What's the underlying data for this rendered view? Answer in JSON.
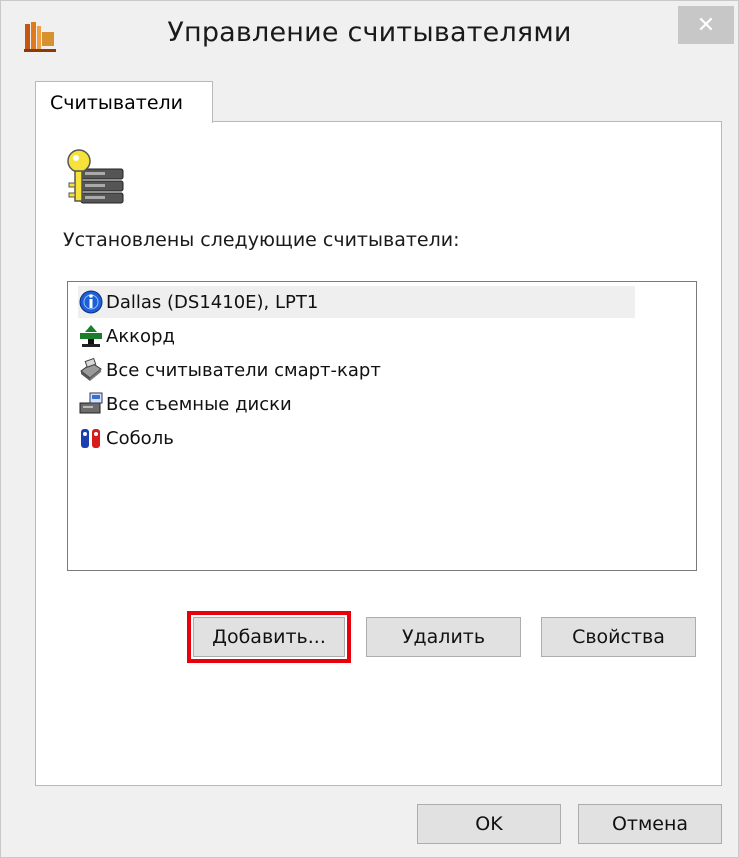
{
  "window": {
    "title": "Управление считывателями",
    "close_glyph": "✕",
    "app_icon": "library-books-icon"
  },
  "tabs": [
    {
      "label": "Считыватели",
      "selected": true
    }
  ],
  "panel": {
    "icon": "keys-and-disks-icon",
    "installed_label": "Установлены следующие считыватели:",
    "readers": [
      {
        "label": "Dallas (DS1410E), LPT1",
        "icon": "info-circle-icon",
        "selected": true
      },
      {
        "label": "Аккорд",
        "icon": "network-device-icon",
        "selected": false
      },
      {
        "label": "Все считыватели смарт-карт",
        "icon": "smart-card-reader-icon",
        "selected": false
      },
      {
        "label": "Все съемные диски",
        "icon": "removable-disk-icon",
        "selected": false
      },
      {
        "label": "Соболь",
        "icon": "sobol-icon",
        "selected": false
      }
    ],
    "buttons": {
      "add": "Добавить...",
      "remove": "Удалить",
      "properties": "Свойства"
    }
  },
  "footer": {
    "ok": "OK",
    "cancel": "Отмена"
  },
  "colors": {
    "highlight": "#e8000b",
    "window_bg": "#f0f0f0",
    "panel_bg": "#ffffff"
  }
}
